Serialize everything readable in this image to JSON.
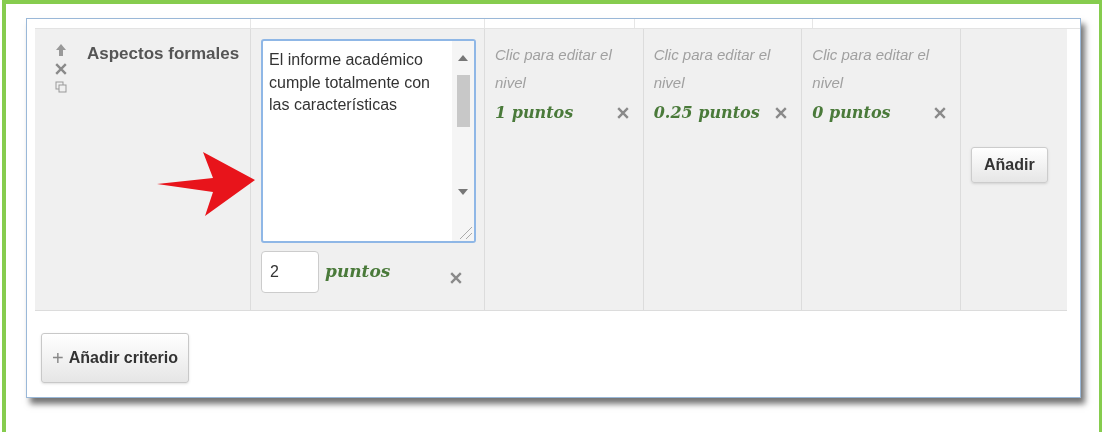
{
  "criterion": {
    "description": "Aspectos formales"
  },
  "levels": [
    {
      "kind": "editing",
      "definition": "El informe académico cumple totalmente con las características",
      "score": "2",
      "unit": "puntos"
    },
    {
      "kind": "placeholder",
      "definition": "Clic para editar el nivel",
      "score": "1 puntos"
    },
    {
      "kind": "placeholder",
      "definition": "Clic para editar el nivel",
      "score": "0.25 puntos"
    },
    {
      "kind": "placeholder",
      "definition": "Clic para editar el nivel",
      "score": "0 puntos"
    }
  ],
  "add_level_button": "Añadir",
  "add_criterion_button": {
    "icon": "+",
    "label": "Añadir criterio"
  }
}
